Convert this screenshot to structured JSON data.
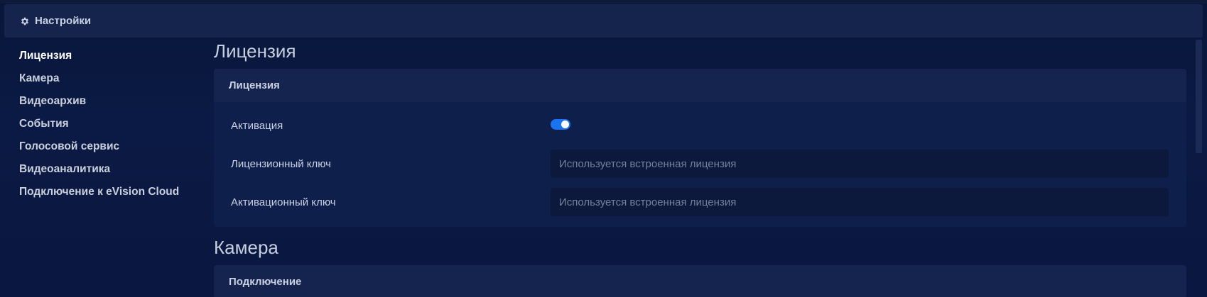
{
  "header": {
    "title": "Настройки",
    "icon": "gear-icon"
  },
  "sidebar": {
    "items": [
      {
        "label": "Лицензия",
        "active": true
      },
      {
        "label": "Камера",
        "active": false
      },
      {
        "label": "Видеоархив",
        "active": false
      },
      {
        "label": "События",
        "active": false
      },
      {
        "label": "Голосовой сервис",
        "active": false
      },
      {
        "label": "Видеоаналитика",
        "active": false
      },
      {
        "label": "Подключение к eVision Cloud",
        "active": false
      }
    ]
  },
  "license_section": {
    "title": "Лицензия",
    "card_title": "Лицензия",
    "activation": {
      "label": "Активация",
      "enabled": true
    },
    "license_key": {
      "label": "Лицензионный ключ",
      "value": "",
      "placeholder": "Используется встроенная лицензия"
    },
    "activation_key": {
      "label": "Активационный ключ",
      "value": "",
      "placeholder": "Используется встроенная лицензия"
    }
  },
  "camera_section": {
    "title": "Камера",
    "card_title": "Подключение"
  },
  "colors": {
    "background": "#0a1a3d",
    "card": "#0f1f4b",
    "card_header": "#14244f",
    "accent": "#1a73f0"
  }
}
